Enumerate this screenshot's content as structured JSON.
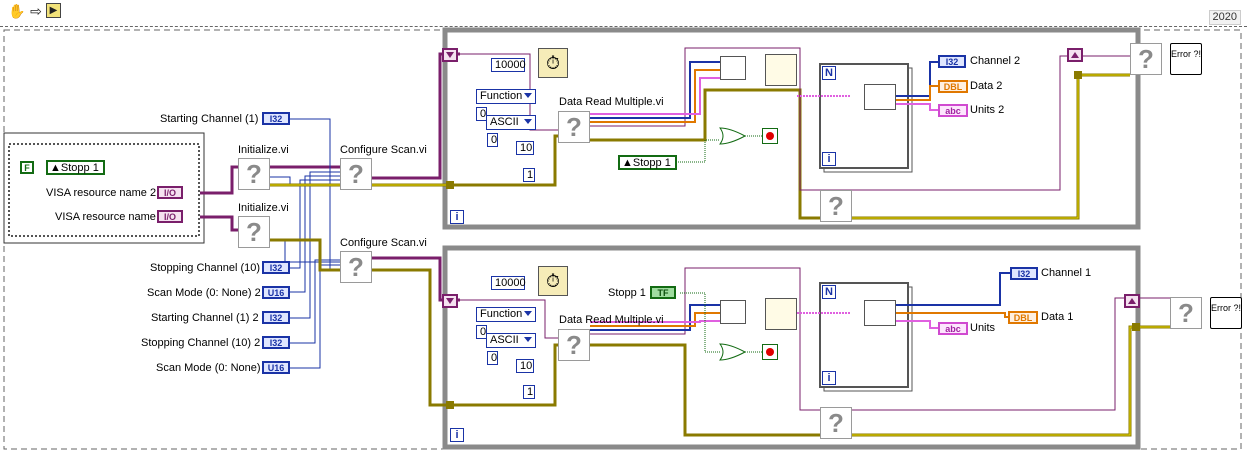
{
  "toolbar": {
    "icons": [
      "hand-tool-icon",
      "step-arrow-icon",
      "run-bd-icon"
    ],
    "year": "2020"
  },
  "left_cluster": {
    "stop_constant": "F",
    "stop_local": "Stopp 1",
    "visa2_label": "VISA resource name 2",
    "visa1_label": "VISA resource name",
    "visa_type": "I/O"
  },
  "controls": {
    "starting_channel_top": "Starting Channel (1)",
    "stopping_channel": "Stopping Channel (10)",
    "scan_mode_2": "Scan Mode (0: None) 2",
    "starting_channel_2": "Starting Channel (1) 2",
    "stopping_channel_2": "Stopping Channel (10) 2",
    "scan_mode": "Scan Mode (0: None)",
    "i32": "I32",
    "u16": "U16"
  },
  "subvis": {
    "initialize_1": "Initialize.vi",
    "initialize_2": "Initialize.vi",
    "configure_1": "Configure Scan.vi",
    "configure_2": "Configure Scan.vi",
    "data_read_1": "Data Read Multiple.vi",
    "data_read_2": "Data Read Multiple.vi",
    "error_label": "Error ?!"
  },
  "loop1": {
    "timer_value": "10000",
    "function_enum": "Function",
    "ascii_enum": "ASCII",
    "zero_a": "0",
    "zero_b": "0",
    "ten": "10",
    "one": "1",
    "stop_local": "Stopp 1",
    "iteration": "i",
    "for_count": "N",
    "for_iter": "i",
    "ch_label": "Channel 2",
    "data_label": "Data 2",
    "units_label": "Units 2",
    "ch_type": "I32",
    "data_type": "DBL",
    "units_type": "abc"
  },
  "loop2": {
    "timer_value": "10000",
    "function_enum": "Function",
    "ascii_enum": "ASCII",
    "zero_a": "0",
    "zero_b": "0",
    "ten": "10",
    "one": "1",
    "stop_label": "Stopp 1",
    "stop_type": "TF",
    "iteration": "i",
    "for_count": "N",
    "for_iter": "i",
    "ch_label": "Channel 1",
    "data_label": "Data 1",
    "units_label": "Units",
    "ch_type": "I32",
    "data_type": "DBL",
    "units_type": "abc"
  },
  "colors": {
    "error_wire": "#c8b400",
    "visa_wire": "#7a1f6b",
    "int_wire": "#1a33a6",
    "dbl_wire": "#e07800",
    "str_wire": "#e060e0",
    "bool_wire": "#136b13",
    "loop_frame": "#8a8a8a"
  }
}
